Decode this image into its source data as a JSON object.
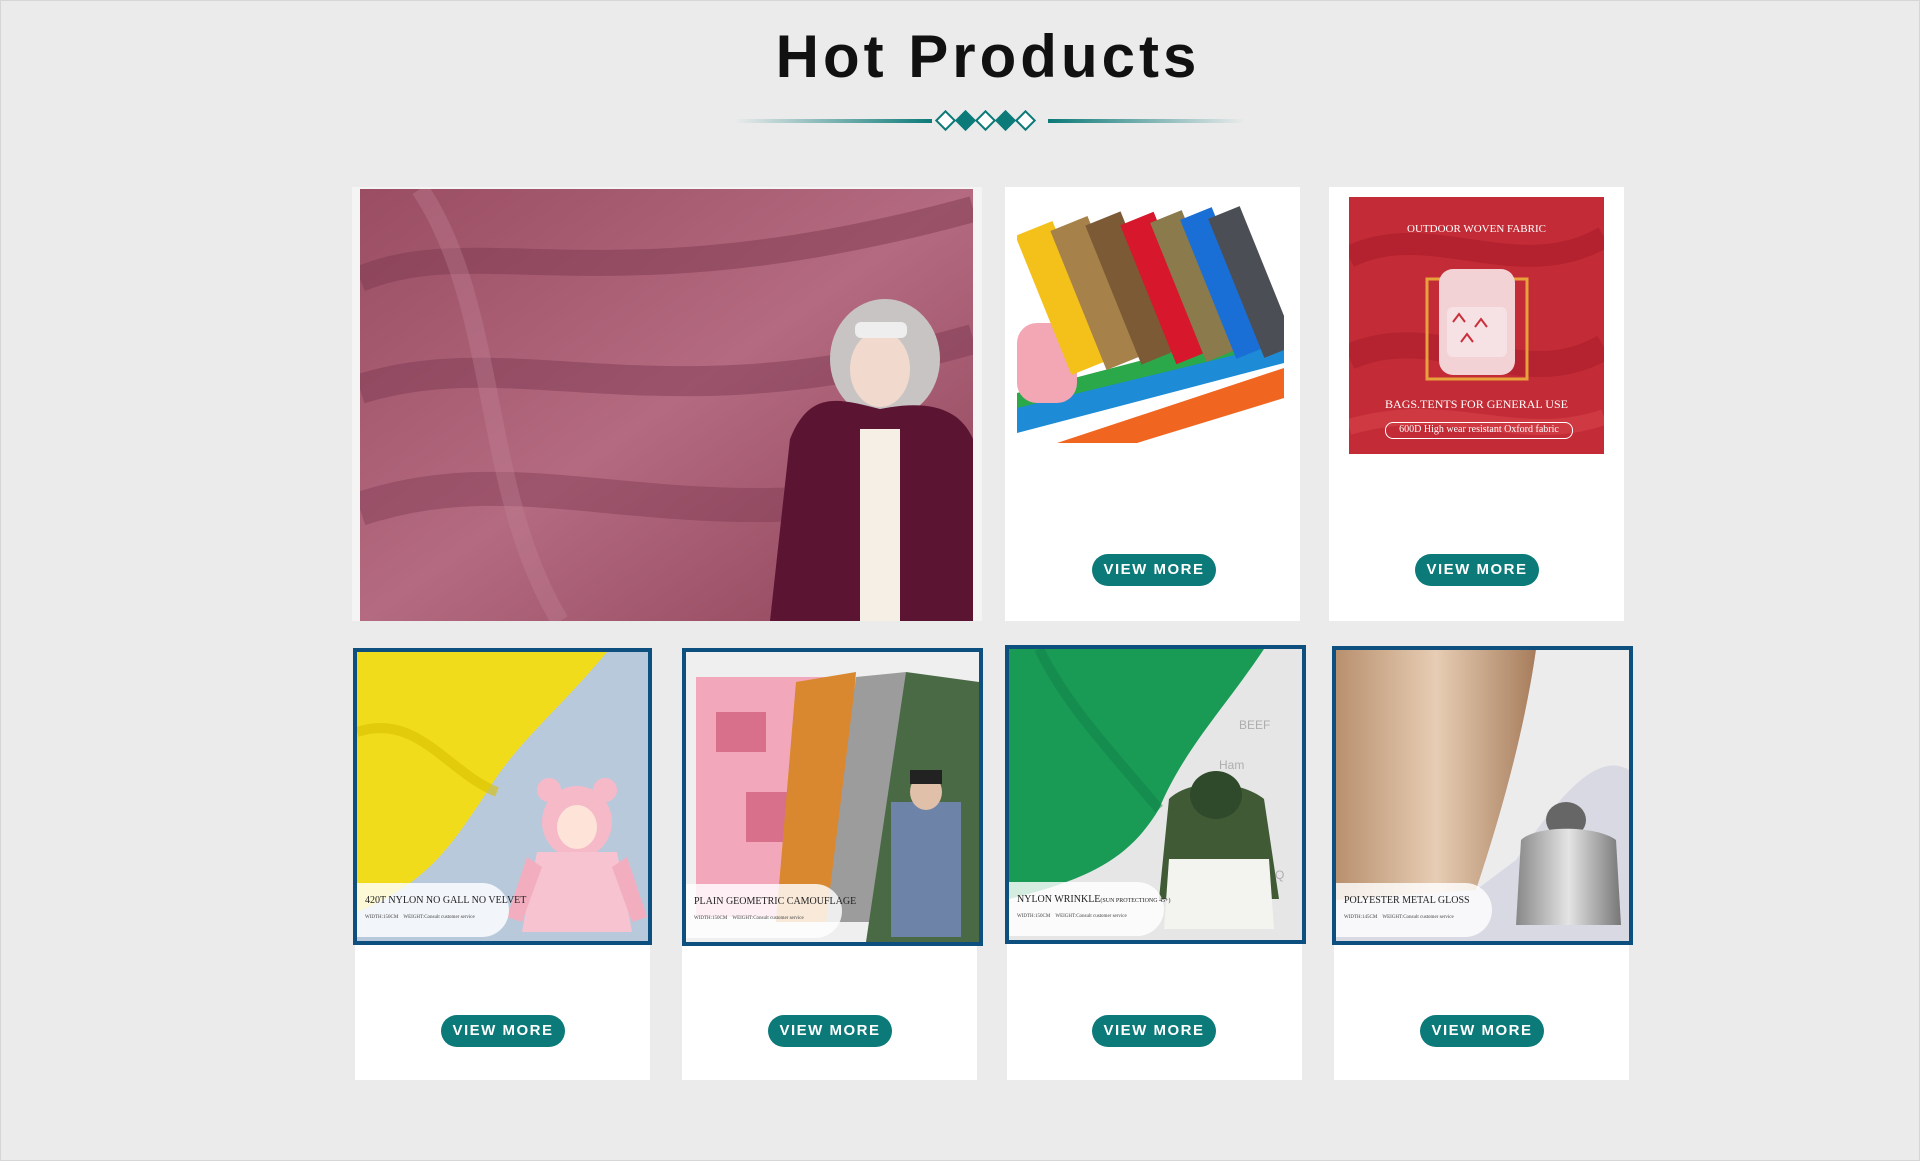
{
  "section": {
    "title": "Hot Products"
  },
  "colors": {
    "accent": "#0b7a78",
    "border": "#0d4f7e",
    "background": "#ebebeb"
  },
  "top_row": [
    {
      "id": "pink-twill",
      "image": "woman in purple hooded parka over mauve twill fabric"
    },
    {
      "id": "color-rolls",
      "image": "rolls of colored coated fabric",
      "button": "VIEW MORE"
    },
    {
      "id": "oxford",
      "image": "red oxford fabric with backpack",
      "banner_top": "OUTDOOR WOVEN FABRIC",
      "banner_mid": "BAGS.TENTS FOR GENERAL USE",
      "banner_pill": "600D High wear resistant Oxford fabric",
      "button": "VIEW MORE"
    }
  ],
  "bottom_row": [
    {
      "id": "nylon-velvet",
      "title": "420T NYLON NO GALL NO VELVET",
      "sub1": "WIDTH:150CM",
      "sub2": "WEIGHT:Consult customer service",
      "button": "VIEW MORE"
    },
    {
      "id": "camouflage",
      "title": "PLAIN GEOMETRIC CAMOUFLAGE",
      "sub1": "WIDTH:150CM",
      "sub2": "WEIGHT:Consult customer service",
      "button": "VIEW MORE"
    },
    {
      "id": "nylon-wrinkle",
      "title": "NYLON WRINKLE",
      "title_small": "(SUN PROTECTIONG 45+)",
      "sub1": "WIDTH:150CM",
      "sub2": "WEIGHT:Consult customer service",
      "button": "VIEW MORE"
    },
    {
      "id": "metal-gloss",
      "title": "POLYESTER METAL GLOSS",
      "sub1": "WIDTH:145CM",
      "sub2": "WEIGHT:Consult customer service",
      "button": "VIEW MORE"
    }
  ]
}
